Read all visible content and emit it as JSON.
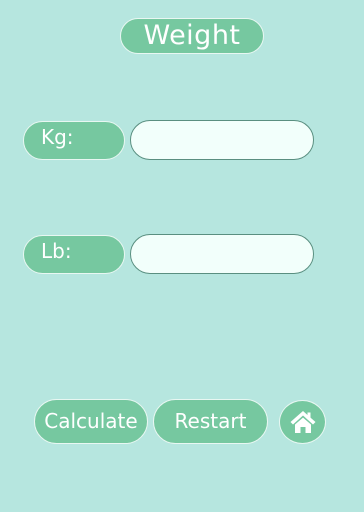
{
  "header": {
    "title": "Weight"
  },
  "form": {
    "kg_label": "Kg:",
    "kg_value": "",
    "lb_label": "Lb:",
    "lb_value": ""
  },
  "actions": {
    "calculate_label": "Calculate",
    "restart_label": "Restart",
    "home_icon": "home-icon"
  },
  "colors": {
    "background": "#b6e6df",
    "accent": "#76c8a0",
    "field_background": "#f2fffb",
    "field_border": "#5a8f80",
    "text_on_accent": "#ffffff"
  }
}
